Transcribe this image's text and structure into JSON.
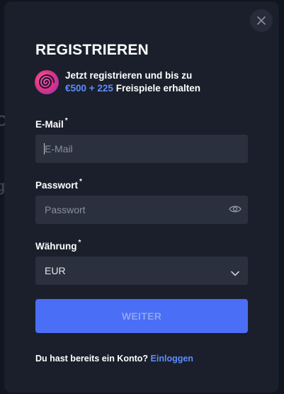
{
  "dialog": {
    "title": "REGISTRIEREN",
    "close_icon": "close-icon",
    "promo": {
      "icon": "spiral-bonus-icon",
      "line1": "Jetzt registrieren und bis zu",
      "accent": "€500 + 225",
      "line2_rest": " Freispiele erhalten"
    },
    "email": {
      "label": "E-Mail",
      "required_mark": "*",
      "placeholder": "E-Mail",
      "value": ""
    },
    "password": {
      "label": "Passwort",
      "required_mark": "*",
      "placeholder": "Passwort",
      "value": "",
      "toggle_icon": "eye-icon"
    },
    "currency": {
      "label": "Währung",
      "required_mark": "*",
      "selected": "EUR",
      "dropdown_icon": "chevron-down-icon"
    },
    "submit_label": "WEITER",
    "footer": {
      "prompt": "Du hast bereits ein Konto?",
      "link": "Einloggen"
    }
  },
  "colors": {
    "backdrop": "#10151f",
    "modal": "#1a1f2b",
    "field": "#2a303d",
    "accent": "#4a6ef5",
    "link": "#5d8cff",
    "text": "#ffffff"
  }
}
